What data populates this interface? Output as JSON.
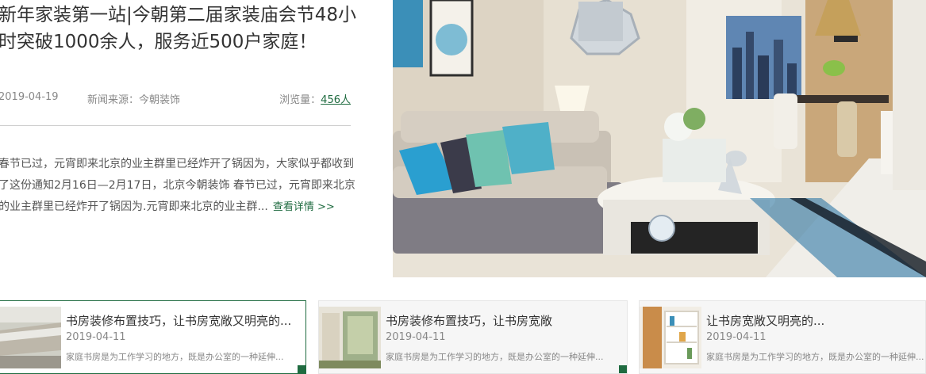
{
  "feature": {
    "title": "新年家装第一站|今朝第二届家装庙会节48小时突破1000余人，服务近500户家庭！",
    "date": "2019-04-19",
    "source": "新闻来源：今朝装饰",
    "views_label": "浏览量：",
    "views_count": "456人",
    "summary": "春节已过，元宵即来北京的业主群里已经炸开了锅因为，大家似乎都收到了这份通知2月16日—2月17日，北京今朝装饰 春节已过，元宵即来北京的业主群里已经炸开了锅因为.元宵即来北京的业主群...",
    "read_more": "查看详情 >>"
  },
  "cards": [
    {
      "title": "书房装修布置技巧，让书房宽敞又明亮的...",
      "date": "2019-04-11",
      "desc": "家庭书房是为工作学习的地方，既是办公室的一种延伸..."
    },
    {
      "title": "书房装修布置技巧，让书房宽敞",
      "date": "2019-04-11",
      "desc": "家庭书房是为工作学习的地方，既是办公室的一种延伸..."
    },
    {
      "title": "让书房宽敞又明亮的...",
      "date": "2019-04-11",
      "desc": "家庭书房是为工作学习的地方，既是办公室的一种延伸..."
    }
  ],
  "colors": {
    "accent": "#1f6b40",
    "text": "#333333",
    "muted": "#888888"
  },
  "icons": {
    "feature_image": "living-room-photo",
    "card_thumbnails": [
      "storefront-photo",
      "shop-sign-photo",
      "bookshelf-photo"
    ]
  }
}
